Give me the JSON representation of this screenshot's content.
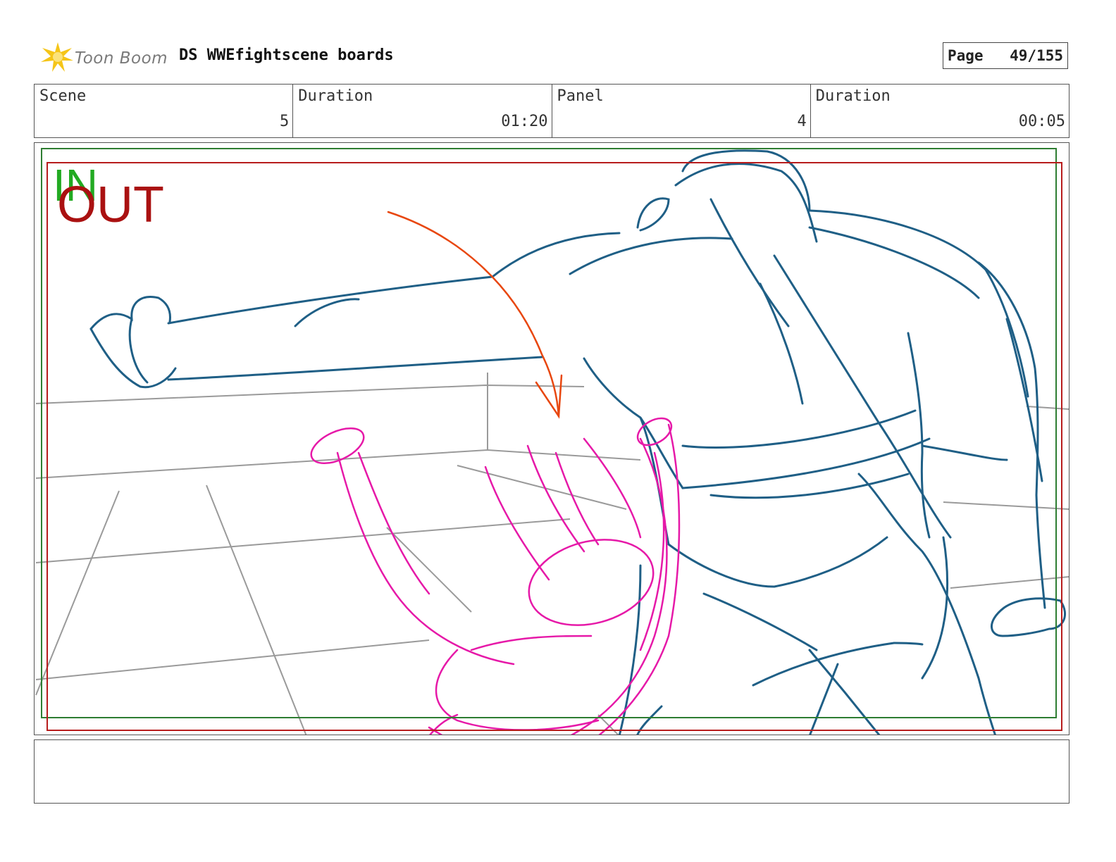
{
  "header": {
    "brand": "Toon Boom",
    "title": "DS WWEfightscene boards",
    "page_label": "Page",
    "page_number": "49/155"
  },
  "info": {
    "scene_label": "Scene",
    "scene_value": "5",
    "scene_duration_label": "Duration",
    "scene_duration_value": "01:20",
    "panel_label": "Panel",
    "panel_value": "4",
    "panel_duration_label": "Duration",
    "panel_duration_value": "00:05"
  },
  "frame": {
    "in_marker": "IN",
    "out_marker": "OUT"
  },
  "colors": {
    "in_frame": "#2e7d32",
    "out_frame": "#b71c1c",
    "character_a": "#1f5f86",
    "character_b": "#e619a8",
    "action_arrow": "#e8470f",
    "set_lines": "#9a9a9a"
  },
  "notes": ""
}
